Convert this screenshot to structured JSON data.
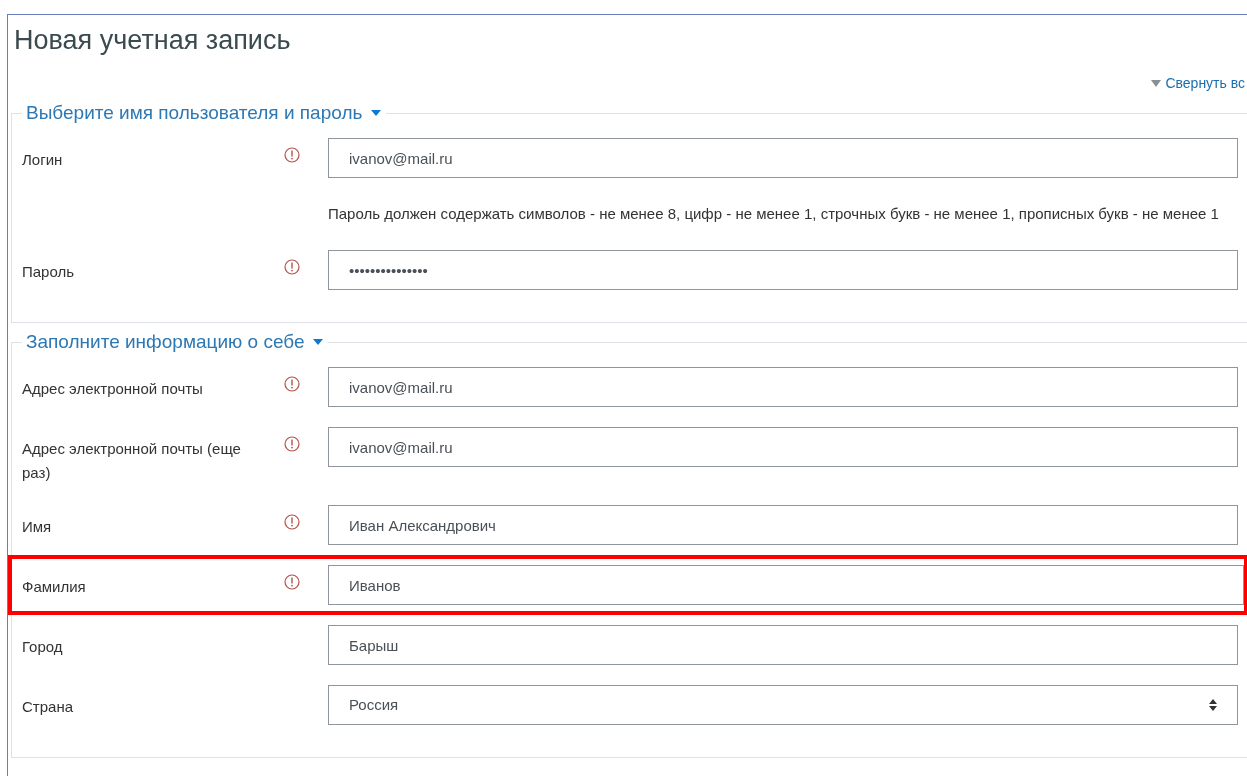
{
  "title": "Новая учетная запись",
  "collapse_all": {
    "label": "Свернуть вс"
  },
  "sections": [
    {
      "legend": "Выберите имя пользователя и пароль",
      "expanded": true,
      "fields": [
        {
          "kind": "text",
          "label": "Логин",
          "required": true,
          "highlighted": false,
          "value": "ivanov@mail.ru"
        },
        {
          "kind": "hint",
          "text": "Пароль должен содержать символов - не менее 8, цифр - не менее 1, строчных букв - не менее 1, прописных букв - не менее 1"
        },
        {
          "kind": "password",
          "label": "Пароль",
          "required": true,
          "highlighted": false,
          "value": "•••••••••••••••"
        }
      ]
    },
    {
      "legend": "Заполните информацию о себе",
      "expanded": true,
      "fields": [
        {
          "kind": "text",
          "label": "Адрес электронной почты",
          "required": true,
          "highlighted": false,
          "value": "ivanov@mail.ru"
        },
        {
          "kind": "text",
          "label": "Адрес электронной почты (еще раз)",
          "required": true,
          "highlighted": false,
          "value": "ivanov@mail.ru"
        },
        {
          "kind": "text",
          "label": "Имя",
          "required": true,
          "highlighted": false,
          "value": "Иван Александрович"
        },
        {
          "kind": "text",
          "label": "Фамилия",
          "required": true,
          "highlighted": true,
          "value": "Иванов"
        },
        {
          "kind": "text",
          "label": "Город",
          "required": false,
          "highlighted": false,
          "value": "Барыш"
        },
        {
          "kind": "select",
          "label": "Страна",
          "required": false,
          "highlighted": false,
          "value": "Россия"
        }
      ]
    }
  ]
}
